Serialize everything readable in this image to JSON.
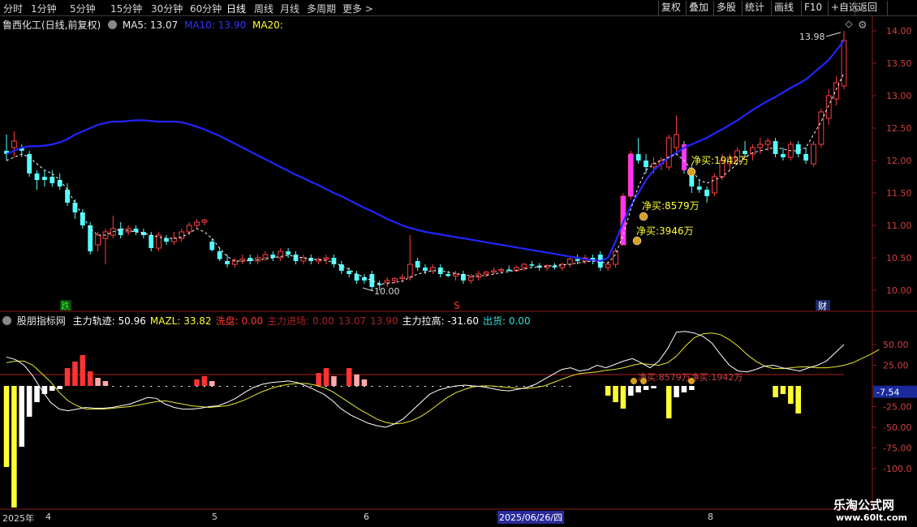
{
  "toolbar": {
    "timeframes": [
      "分时",
      "1分钟",
      "5分钟",
      "15分钟",
      "30分钟",
      "60分钟",
      "日线",
      "周线",
      "月线",
      "多周期",
      "更多 >"
    ],
    "active": "日线",
    "buttons": [
      "复权",
      "叠加",
      "多股",
      "统计",
      "画线",
      "F10",
      "+自选",
      "返回"
    ]
  },
  "stock": {
    "title": "鲁西化工(日线,前复权)",
    "ma5": "MA5: 13.07",
    "ma10": "MA10: 13.90",
    "ma20": "MA20:"
  },
  "price_axis": [
    "14.00",
    "13.50",
    "13.00",
    "12.50",
    "12.00",
    "11.50",
    "11.00",
    "10.50",
    "10.00"
  ],
  "price_annotations": {
    "high": "13.98",
    "low": "10.00",
    "net_buy_1": "净买:8579万",
    "net_buy_2": "净买:3946万",
    "net_buy_3": "净买:1942万",
    "die": "跌",
    "s": "S",
    "cai": "财"
  },
  "indicator": {
    "name": "股朋指标网",
    "items": [
      {
        "text": "主力轨迹: 50.96",
        "color": "#ffffff"
      },
      {
        "text": "MAZL: 33.82",
        "color": "#ffff33"
      },
      {
        "text": "洗盘: 0.00",
        "color": "#ff3333"
      },
      {
        "text": "主力进场: 0.00",
        "color": "#aa2222"
      },
      {
        "text": "13.07",
        "color": "#aa2222"
      },
      {
        "text": "13.90",
        "color": "#aa2222"
      },
      {
        "text": "主力拉高: -31.60",
        "color": "#ffffff"
      },
      {
        "text": "出货: 0.00",
        "color": "#33dddd"
      }
    ],
    "axis": [
      "50.00",
      "25.00",
      "-25.00",
      "-50.00",
      "-75.00",
      "-100.0"
    ],
    "current": "-7.54",
    "annotation": "净买:8579万净买:1942万"
  },
  "date_axis": {
    "labels": [
      "2025年",
      "4",
      "5",
      "6",
      "2025/06/26/四",
      "8"
    ]
  },
  "watermark": {
    "title": "乐淘公式网",
    "url": "www.60lt.com"
  },
  "chart_data": {
    "type": "candlestick",
    "ylim": [
      9.85,
      14.15
    ],
    "candles": [
      {
        "o": 12.15,
        "h": 12.4,
        "l": 12.0,
        "c": 12.1
      },
      {
        "o": 12.2,
        "h": 12.45,
        "l": 12.05,
        "c": 12.3
      },
      {
        "o": 12.2,
        "h": 12.25,
        "l": 12.05,
        "c": 12.15
      },
      {
        "o": 12.1,
        "h": 12.15,
        "l": 11.75,
        "c": 11.8
      },
      {
        "o": 11.8,
        "h": 11.85,
        "l": 11.55,
        "c": 11.7
      },
      {
        "o": 11.75,
        "h": 11.85,
        "l": 11.6,
        "c": 11.7
      },
      {
        "o": 11.75,
        "h": 11.85,
        "l": 11.6,
        "c": 11.65
      },
      {
        "o": 11.7,
        "h": 11.8,
        "l": 11.55,
        "c": 11.6
      },
      {
        "o": 11.55,
        "h": 11.65,
        "l": 11.3,
        "c": 11.35
      },
      {
        "o": 11.35,
        "h": 11.4,
        "l": 11.1,
        "c": 11.2
      },
      {
        "o": 11.2,
        "h": 11.25,
        "l": 10.95,
        "c": 11.0
      },
      {
        "o": 11.0,
        "h": 11.05,
        "l": 10.55,
        "c": 10.6
      },
      {
        "o": 10.7,
        "h": 10.9,
        "l": 10.6,
        "c": 10.85
      },
      {
        "o": 10.8,
        "h": 10.95,
        "l": 10.4,
        "c": 10.9
      },
      {
        "o": 10.85,
        "h": 11.15,
        "l": 10.8,
        "c": 10.95
      },
      {
        "o": 10.95,
        "h": 11.05,
        "l": 10.8,
        "c": 10.85
      },
      {
        "o": 10.9,
        "h": 11.0,
        "l": 10.85,
        "c": 10.95
      },
      {
        "o": 10.95,
        "h": 11.0,
        "l": 10.85,
        "c": 10.9
      },
      {
        "o": 10.9,
        "h": 10.95,
        "l": 10.8,
        "c": 10.85
      },
      {
        "o": 10.85,
        "h": 10.9,
        "l": 10.6,
        "c": 10.65
      },
      {
        "o": 10.65,
        "h": 10.9,
        "l": 10.6,
        "c": 10.85
      },
      {
        "o": 10.8,
        "h": 10.85,
        "l": 10.7,
        "c": 10.75
      },
      {
        "o": 10.75,
        "h": 10.9,
        "l": 10.7,
        "c": 10.8
      },
      {
        "o": 10.8,
        "h": 10.95,
        "l": 10.75,
        "c": 10.9
      },
      {
        "o": 10.9,
        "h": 11.05,
        "l": 10.85,
        "c": 11.0
      },
      {
        "o": 11.0,
        "h": 11.1,
        "l": 10.95,
        "c": 11.05
      },
      {
        "o": 11.05,
        "h": 11.1,
        "l": 11.0,
        "c": 11.08
      },
      {
        "o": 10.75,
        "h": 10.8,
        "l": 10.6,
        "c": 10.62
      },
      {
        "o": 10.6,
        "h": 10.65,
        "l": 10.45,
        "c": 10.48
      },
      {
        "o": 10.45,
        "h": 10.55,
        "l": 10.35,
        "c": 10.4
      },
      {
        "o": 10.4,
        "h": 10.5,
        "l": 10.35,
        "c": 10.45
      },
      {
        "o": 10.45,
        "h": 10.55,
        "l": 10.4,
        "c": 10.48
      },
      {
        "o": 10.5,
        "h": 10.55,
        "l": 10.4,
        "c": 10.45
      },
      {
        "o": 10.45,
        "h": 10.55,
        "l": 10.4,
        "c": 10.5
      },
      {
        "o": 10.5,
        "h": 10.6,
        "l": 10.45,
        "c": 10.55
      },
      {
        "o": 10.55,
        "h": 10.6,
        "l": 10.45,
        "c": 10.5
      },
      {
        "o": 10.5,
        "h": 10.65,
        "l": 10.45,
        "c": 10.6
      },
      {
        "o": 10.6,
        "h": 10.65,
        "l": 10.5,
        "c": 10.55
      },
      {
        "o": 10.55,
        "h": 10.6,
        "l": 10.4,
        "c": 10.45
      },
      {
        "o": 10.45,
        "h": 10.55,
        "l": 10.4,
        "c": 10.5
      },
      {
        "o": 10.5,
        "h": 10.55,
        "l": 10.4,
        "c": 10.45
      },
      {
        "o": 10.45,
        "h": 10.5,
        "l": 10.4,
        "c": 10.48
      },
      {
        "o": 10.48,
        "h": 10.55,
        "l": 10.4,
        "c": 10.5
      },
      {
        "o": 10.5,
        "h": 10.55,
        "l": 10.35,
        "c": 10.4
      },
      {
        "o": 10.4,
        "h": 10.45,
        "l": 10.25,
        "c": 10.3
      },
      {
        "o": 10.3,
        "h": 10.35,
        "l": 10.2,
        "c": 10.25
      },
      {
        "o": 10.25,
        "h": 10.3,
        "l": 10.1,
        "c": 10.15
      },
      {
        "o": 10.2,
        "h": 10.25,
        "l": 10.1,
        "c": 10.15
      },
      {
        "o": 10.25,
        "h": 10.3,
        "l": 10.0,
        "c": 10.05
      },
      {
        "o": 10.1,
        "h": 10.15,
        "l": 10.0,
        "c": 10.08
      },
      {
        "o": 10.12,
        "h": 10.2,
        "l": 10.05,
        "c": 10.15
      },
      {
        "o": 10.15,
        "h": 10.2,
        "l": 10.1,
        "c": 10.18
      },
      {
        "o": 10.18,
        "h": 10.25,
        "l": 10.12,
        "c": 10.2
      },
      {
        "o": 10.2,
        "h": 10.85,
        "l": 10.15,
        "c": 10.4
      },
      {
        "o": 10.45,
        "h": 10.5,
        "l": 10.3,
        "c": 10.35
      },
      {
        "o": 10.35,
        "h": 10.4,
        "l": 10.25,
        "c": 10.3
      },
      {
        "o": 10.3,
        "h": 10.4,
        "l": 10.25,
        "c": 10.35
      },
      {
        "o": 10.35,
        "h": 10.4,
        "l": 10.2,
        "c": 10.25
      },
      {
        "o": 10.25,
        "h": 10.3,
        "l": 10.2,
        "c": 10.22
      },
      {
        "o": 10.22,
        "h": 10.3,
        "l": 10.15,
        "c": 10.25
      },
      {
        "o": 10.25,
        "h": 10.3,
        "l": 10.1,
        "c": 10.15
      },
      {
        "o": 10.15,
        "h": 10.25,
        "l": 10.1,
        "c": 10.2
      },
      {
        "o": 10.2,
        "h": 10.3,
        "l": 10.15,
        "c": 10.25
      },
      {
        "o": 10.25,
        "h": 10.3,
        "l": 10.2,
        "c": 10.28
      },
      {
        "o": 10.28,
        "h": 10.35,
        "l": 10.25,
        "c": 10.3
      },
      {
        "o": 10.3,
        "h": 10.35,
        "l": 10.25,
        "c": 10.32
      },
      {
        "o": 10.32,
        "h": 10.38,
        "l": 10.28,
        "c": 10.3
      },
      {
        "o": 10.3,
        "h": 10.38,
        "l": 10.28,
        "c": 10.35
      },
      {
        "o": 10.35,
        "h": 10.42,
        "l": 10.3,
        "c": 10.4
      },
      {
        "o": 10.4,
        "h": 10.45,
        "l": 10.35,
        "c": 10.38
      },
      {
        "o": 10.38,
        "h": 10.42,
        "l": 10.3,
        "c": 10.35
      },
      {
        "o": 10.35,
        "h": 10.4,
        "l": 10.3,
        "c": 10.38
      },
      {
        "o": 10.38,
        "h": 10.42,
        "l": 10.32,
        "c": 10.35
      },
      {
        "o": 10.35,
        "h": 10.42,
        "l": 10.3,
        "c": 10.4
      },
      {
        "o": 10.4,
        "h": 10.5,
        "l": 10.35,
        "c": 10.48
      },
      {
        "o": 10.48,
        "h": 10.55,
        "l": 10.4,
        "c": 10.45
      },
      {
        "o": 10.45,
        "h": 10.55,
        "l": 10.4,
        "c": 10.5
      },
      {
        "o": 10.5,
        "h": 10.55,
        "l": 10.4,
        "c": 10.45
      },
      {
        "o": 10.55,
        "h": 10.6,
        "l": 10.3,
        "c": 10.35
      },
      {
        "o": 10.35,
        "h": 10.45,
        "l": 10.3,
        "c": 10.4
      },
      {
        "o": 10.4,
        "h": 10.65,
        "l": 10.35,
        "c": 10.6
      },
      {
        "o": 10.7,
        "h": 11.5,
        "l": 10.7,
        "c": 11.45
      },
      {
        "o": 11.45,
        "h": 12.15,
        "l": 11.4,
        "c": 12.1
      },
      {
        "o": 12.1,
        "h": 12.35,
        "l": 11.95,
        "c": 12.0
      },
      {
        "o": 12.0,
        "h": 12.1,
        "l": 11.8,
        "c": 11.9
      },
      {
        "o": 11.9,
        "h": 12.05,
        "l": 11.8,
        "c": 11.95
      },
      {
        "o": 11.95,
        "h": 12.05,
        "l": 11.85,
        "c": 12.0
      },
      {
        "o": 11.9,
        "h": 12.4,
        "l": 11.85,
        "c": 12.35
      },
      {
        "o": 12.2,
        "h": 12.7,
        "l": 12.1,
        "c": 12.4
      },
      {
        "o": 12.25,
        "h": 12.3,
        "l": 11.8,
        "c": 11.85
      },
      {
        "o": 11.85,
        "h": 11.95,
        "l": 11.5,
        "c": 11.6
      },
      {
        "o": 11.6,
        "h": 11.7,
        "l": 11.5,
        "c": 11.55
      },
      {
        "o": 11.55,
        "h": 11.6,
        "l": 11.35,
        "c": 11.45
      },
      {
        "o": 11.5,
        "h": 11.8,
        "l": 11.45,
        "c": 11.75
      },
      {
        "o": 11.75,
        "h": 12.1,
        "l": 11.7,
        "c": 12.0
      },
      {
        "o": 11.95,
        "h": 12.1,
        "l": 11.85,
        "c": 12.05
      },
      {
        "o": 12.0,
        "h": 12.2,
        "l": 11.95,
        "c": 12.15
      },
      {
        "o": 12.15,
        "h": 12.3,
        "l": 12.05,
        "c": 12.1
      },
      {
        "o": 12.1,
        "h": 12.25,
        "l": 12.0,
        "c": 12.2
      },
      {
        "o": 12.2,
        "h": 12.35,
        "l": 12.1,
        "c": 12.25
      },
      {
        "o": 12.25,
        "h": 12.35,
        "l": 12.15,
        "c": 12.3
      },
      {
        "o": 12.3,
        "h": 12.35,
        "l": 12.05,
        "c": 12.1
      },
      {
        "o": 12.1,
        "h": 12.2,
        "l": 12.0,
        "c": 12.05
      },
      {
        "o": 12.05,
        "h": 12.3,
        "l": 12.0,
        "c": 12.25
      },
      {
        "o": 12.25,
        "h": 12.3,
        "l": 12.05,
        "c": 12.1
      },
      {
        "o": 12.1,
        "h": 12.2,
        "l": 11.95,
        "c": 12.0
      },
      {
        "o": 11.95,
        "h": 12.3,
        "l": 11.9,
        "c": 12.25
      },
      {
        "o": 12.25,
        "h": 12.8,
        "l": 12.2,
        "c": 12.75
      },
      {
        "o": 12.65,
        "h": 13.1,
        "l": 12.55,
        "c": 13.0
      },
      {
        "o": 12.95,
        "h": 13.3,
        "l": 12.85,
        "c": 13.2
      },
      {
        "o": 13.15,
        "h": 14.0,
        "l": 13.1,
        "c": 13.85
      }
    ],
    "ma10": [
      12.1,
      12.15,
      12.2,
      12.22,
      12.22,
      12.23,
      12.25,
      12.28,
      12.33,
      12.4,
      12.45,
      12.5,
      12.55,
      12.58,
      12.6,
      12.6,
      12.61,
      12.62,
      12.62,
      12.61,
      12.6,
      12.6,
      12.6,
      12.59,
      12.56,
      12.52,
      12.48,
      12.43,
      12.38,
      12.32,
      12.26,
      12.2,
      12.14,
      12.08,
      12.02,
      11.96,
      11.9,
      11.84,
      11.78,
      11.73,
      11.67,
      11.62,
      11.56,
      11.5,
      11.45,
      11.39,
      11.33,
      11.27,
      11.22,
      11.16,
      11.1,
      11.05,
      11.0,
      10.96,
      10.93,
      10.9,
      10.88,
      10.86,
      10.84,
      10.82,
      10.8,
      10.78,
      10.76,
      10.74,
      10.72,
      10.7,
      10.68,
      10.66,
      10.64,
      10.62,
      10.6,
      10.58,
      10.56,
      10.54,
      10.52,
      10.5,
      10.48,
      10.46,
      10.45,
      10.5,
      10.75,
      11.05,
      11.3,
      11.5,
      11.7,
      11.85,
      11.95,
      12.05,
      12.12,
      12.2,
      12.25,
      12.3,
      12.35,
      12.42,
      12.48,
      12.55,
      12.62,
      12.7,
      12.78,
      12.85,
      12.92,
      12.98,
      13.05,
      13.12,
      13.18,
      13.25,
      13.35,
      13.45,
      13.55,
      13.7,
      13.85
    ],
    "ma5": [
      12.0,
      12.05,
      12.1,
      12.05,
      11.95,
      11.85,
      11.8,
      11.7,
      11.55,
      11.35,
      11.15,
      10.95,
      10.85,
      10.85,
      10.9,
      10.95,
      10.92,
      10.9,
      10.88,
      10.85,
      10.82,
      10.8,
      10.8,
      10.82,
      10.88,
      10.95,
      10.9,
      10.8,
      10.65,
      10.52,
      10.45,
      10.45,
      10.46,
      10.47,
      10.48,
      10.5,
      10.52,
      10.54,
      10.52,
      10.5,
      10.48,
      10.47,
      10.46,
      10.43,
      10.38,
      10.32,
      10.25,
      10.2,
      10.15,
      10.1,
      10.1,
      10.12,
      10.14,
      10.2,
      10.25,
      10.28,
      10.3,
      10.3,
      10.28,
      10.26,
      10.24,
      10.22,
      10.22,
      10.23,
      10.25,
      10.27,
      10.29,
      10.31,
      10.33,
      10.35,
      10.36,
      10.37,
      10.38,
      10.39,
      10.4,
      10.42,
      10.44,
      10.45,
      10.43,
      10.42,
      10.55,
      10.85,
      11.25,
      11.6,
      11.85,
      11.95,
      12.0,
      12.05,
      12.1,
      12.0,
      11.85,
      11.7,
      11.65,
      11.7,
      11.75,
      11.85,
      11.95,
      12.05,
      12.12,
      12.15,
      12.18,
      12.2,
      12.18,
      12.15,
      12.15,
      12.2,
      12.4,
      12.6,
      12.85,
      13.1,
      13.35
    ],
    "indicator": {
      "ylim": [
        -115,
        75
      ],
      "track": [
        35,
        32,
        25,
        12,
        -5,
        -20,
        -28,
        -30,
        -28,
        -26,
        -27,
        -27,
        -26,
        -24,
        -22,
        -18,
        -14,
        -15,
        -22,
        -26,
        -28,
        -28,
        -27,
        -25,
        -24,
        -20,
        -15,
        -8,
        -2,
        2,
        4,
        5,
        6,
        4,
        0,
        -5,
        -10,
        -18,
        -28,
        -35,
        -40,
        -45,
        -48,
        -50,
        -46,
        -40,
        -30,
        -20,
        -10,
        -5,
        -2,
        0,
        1,
        0,
        -1,
        -3,
        -5,
        -6,
        -4,
        -2,
        2,
        8,
        14,
        20,
        22,
        18,
        20,
        25,
        22,
        26,
        30,
        33,
        28,
        22,
        30,
        45,
        65,
        66,
        64,
        60,
        52,
        38,
        25,
        18,
        17,
        20,
        24,
        25,
        22,
        20,
        18,
        22,
        25,
        30,
        40,
        50
      ],
      "mazl": [
        28,
        30,
        30,
        25,
        15,
        5,
        -8,
        -18,
        -24,
        -28,
        -28,
        -28,
        -27,
        -26,
        -25,
        -23,
        -21,
        -19,
        -18,
        -20,
        -22,
        -24,
        -25,
        -26,
        -25,
        -24,
        -21,
        -17,
        -12,
        -7,
        -3,
        0,
        2,
        3,
        3,
        1,
        -2,
        -7,
        -14,
        -21,
        -28,
        -34,
        -40,
        -44,
        -46,
        -45,
        -42,
        -37,
        -30,
        -22,
        -14,
        -8,
        -4,
        -1,
        0,
        0,
        -1,
        -2,
        -3,
        -3,
        -2,
        0,
        4,
        8,
        12,
        15,
        16,
        17,
        19,
        20,
        22,
        25,
        27,
        26,
        25,
        28,
        36,
        48,
        58,
        63,
        64,
        62,
        56,
        48,
        38,
        30,
        24,
        21,
        21,
        22,
        23,
        23,
        22,
        22,
        23,
        25,
        28,
        33,
        38,
        44
      ]
    }
  }
}
